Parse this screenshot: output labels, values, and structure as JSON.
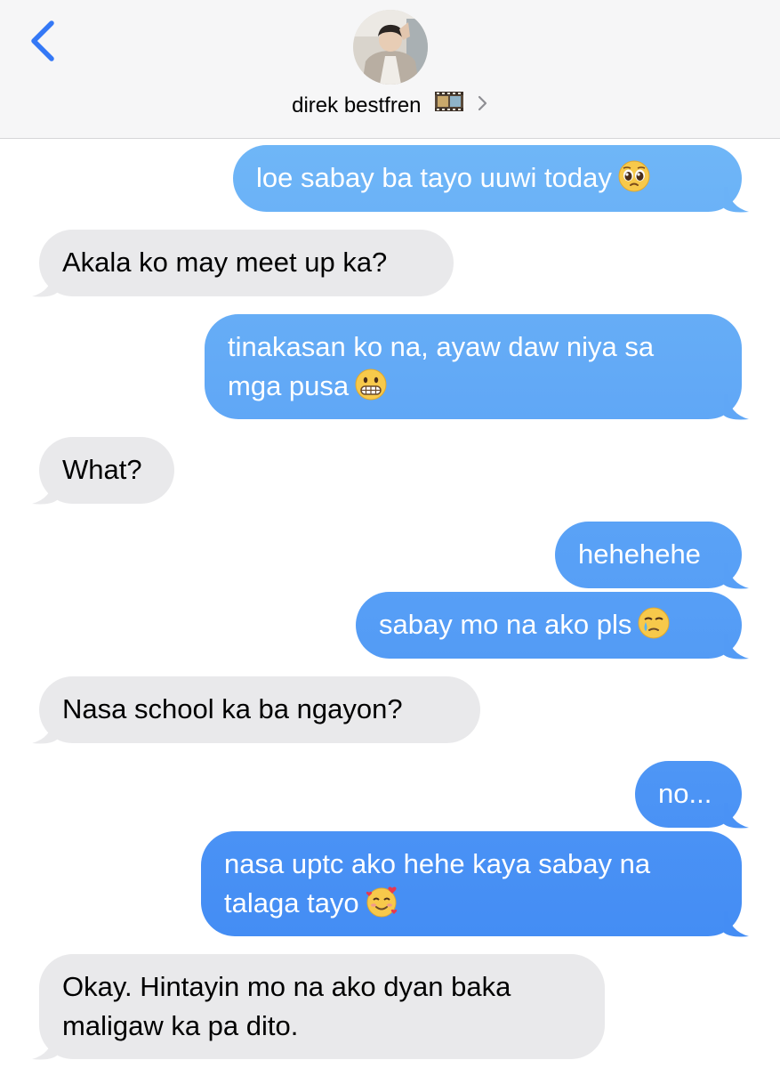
{
  "header": {
    "back_icon": "chevron-left-icon",
    "contact_name": "direk bestfren",
    "name_emoji": "film-frames-icon",
    "details_icon": "chevron-right-icon",
    "accent": "#3b82f6"
  },
  "messages": [
    {
      "dir": "out",
      "text": "loe sabay ba tayo uuwi today",
      "emoji": "pleading-face"
    },
    {
      "dir": "in",
      "text": "Akala ko may meet up ka?"
    },
    {
      "dir": "out",
      "text": "tinakasan ko na, ayaw daw niya sa\nmga pusa",
      "emoji": "grimacing-face"
    },
    {
      "dir": "in",
      "text": "What?"
    },
    {
      "dir": "out",
      "text": "hehehehe"
    },
    {
      "dir": "out",
      "text": "sabay mo na ako pls",
      "emoji": "face-holding-back-tears"
    },
    {
      "dir": "in",
      "text": "Nasa school ka ba ngayon?"
    },
    {
      "dir": "out",
      "text": "no..."
    },
    {
      "dir": "out",
      "text": "nasa uptc ako hehe kaya sabay na\ntalaga tayo",
      "emoji": "smiling-face-with-hearts"
    },
    {
      "dir": "in",
      "text": "Okay. Hintayin mo na ako dyan baka\nmaligaw ka pa dito."
    }
  ],
  "colors": {
    "outgoing_top": "#6fb6f7",
    "outgoing_bottom": "#3d86f4",
    "incoming": "#e9e9eb",
    "header_bg": "#f6f6f7"
  }
}
